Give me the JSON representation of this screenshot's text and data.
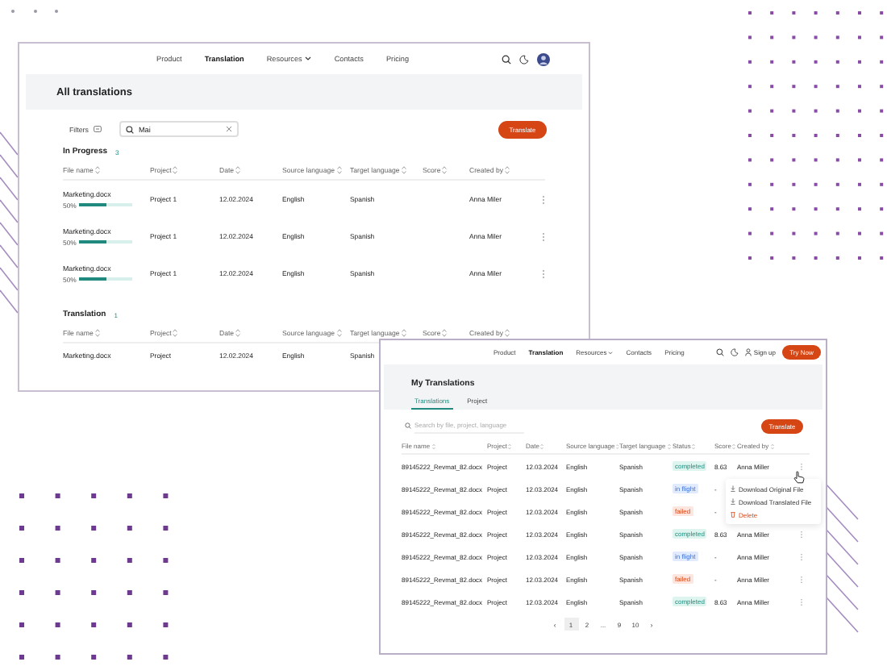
{
  "all_translations": {
    "nav": [
      {
        "label": "Product",
        "selected": false,
        "dropdown": false
      },
      {
        "label": "Translation",
        "selected": true,
        "dropdown": false
      },
      {
        "label": "Resources",
        "selected": false,
        "dropdown": true
      },
      {
        "label": "Contacts",
        "selected": false,
        "dropdown": false
      },
      {
        "label": "Pricing",
        "selected": false,
        "dropdown": false
      }
    ],
    "title": "All translations",
    "filters": {
      "label": "Filters"
    },
    "search": {
      "value": "Mai"
    },
    "translate_button": "Translate",
    "sections": [
      {
        "title": "In Progress",
        "count": "3",
        "columns": [
          "File name",
          "Project",
          "Date",
          "Source language",
          "Target language",
          "Score",
          "Created by"
        ],
        "rows": [
          {
            "file_name": "Marketing.docx",
            "progress": "50%",
            "level": 0.5,
            "project": "Project 1",
            "date": "12.02.2024",
            "source_language": "English",
            "target_language": "Spanish",
            "created_by": "Anna Miler"
          },
          {
            "file_name": "Marketing.docx",
            "progress": "50%",
            "level": 0.5,
            "project": "Project 1",
            "date": "12.02.2024",
            "source_language": "English",
            "target_language": "Spanish",
            "created_by": "Anna Miler"
          },
          {
            "file_name": "Marketing.docx",
            "progress": "50%",
            "level": 0.5,
            "project": "Project 1",
            "date": "12.02.2024",
            "source_language": "English",
            "target_language": "Spanish",
            "created_by": "Anna Miler"
          }
        ]
      },
      {
        "title": "Translation",
        "count": "1",
        "columns": [
          "File name",
          "Project",
          "Date",
          "Source language",
          "Target language",
          "Score",
          "Created by"
        ],
        "rows": [
          {
            "file_name": "Marketing.docx",
            "project": "Project",
            "date": "12.02.2024",
            "source_language": "English",
            "target_language": "Spanish"
          }
        ]
      }
    ]
  },
  "my_translations": {
    "nav": [
      {
        "label": "Product",
        "selected": false,
        "dropdown": false
      },
      {
        "label": "Translation",
        "selected": true,
        "dropdown": false
      },
      {
        "label": "Resources",
        "selected": false,
        "dropdown": true
      },
      {
        "label": "Contacts",
        "selected": false,
        "dropdown": false
      },
      {
        "label": "Pricing",
        "selected": false,
        "dropdown": false
      }
    ],
    "sign_up": "Sign up",
    "try_button": "Try Now",
    "title": "My Translations",
    "tabs": [
      {
        "label": "Translations",
        "selected": true
      },
      {
        "label": "Project",
        "selected": false
      }
    ],
    "search": {
      "placeholder": "Search by file, project, language"
    },
    "translate_button": "Translate",
    "columns": [
      "File name",
      "Project",
      "Date",
      "Source language",
      "Target language",
      "Status",
      "Score",
      "Created by"
    ],
    "rows": [
      {
        "file_name": "89145222_Revmat_82.docx",
        "project": "Project",
        "date": "12.03.2024",
        "source_language": "English",
        "target_language": "Spanish",
        "status": "completed",
        "kind": "completed",
        "score": "8.63",
        "created_by": "Anna Miller"
      },
      {
        "file_name": "89145222_Revmat_82.docx",
        "project": "Project",
        "date": "12.03.2024",
        "source_language": "English",
        "target_language": "Spanish",
        "status": "in flight",
        "kind": "progress",
        "score": "-"
      },
      {
        "file_name": "89145222_Revmat_82.docx",
        "project": "Project",
        "date": "12.03.2024",
        "source_language": "English",
        "target_language": "Spanish",
        "status": "failed",
        "kind": "failed",
        "score": "-"
      },
      {
        "file_name": "89145222_Revmat_82.docx",
        "project": "Project",
        "date": "12.03.2024",
        "source_language": "English",
        "target_language": "Spanish",
        "status": "completed",
        "kind": "completed",
        "score": "8.63",
        "created_by": "Anna Miller"
      },
      {
        "file_name": "89145222_Revmat_82.docx",
        "project": "Project",
        "date": "12.03.2024",
        "source_language": "English",
        "target_language": "Spanish",
        "status": "in flight",
        "kind": "progress",
        "score": "-",
        "created_by": "Anna Miller"
      },
      {
        "file_name": "89145222_Revmat_82.docx",
        "project": "Project",
        "date": "12.03.2024",
        "source_language": "English",
        "target_language": "Spanish",
        "status": "failed",
        "kind": "failed",
        "score": "-",
        "created_by": "Anna Miller"
      },
      {
        "file_name": "89145222_Revmat_82.docx",
        "project": "Project",
        "date": "12.03.2024",
        "source_language": "English",
        "target_language": "Spanish",
        "status": "completed",
        "kind": "completed",
        "score": "8.63",
        "created_by": "Anna Miller"
      }
    ],
    "row_menu": [
      {
        "label": "Download Original File",
        "kind": "download"
      },
      {
        "label": "Download Translated File",
        "kind": "download"
      },
      {
        "label": "Delete",
        "kind": "delete"
      }
    ],
    "pagination": [
      {
        "label": "‹",
        "selected": false
      },
      {
        "label": "1",
        "selected": true
      },
      {
        "label": "2",
        "selected": false
      },
      {
        "label": "...",
        "selected": false
      },
      {
        "label": "9",
        "selected": false
      },
      {
        "label": "10",
        "selected": false
      },
      {
        "label": "›",
        "selected": false
      }
    ]
  }
}
